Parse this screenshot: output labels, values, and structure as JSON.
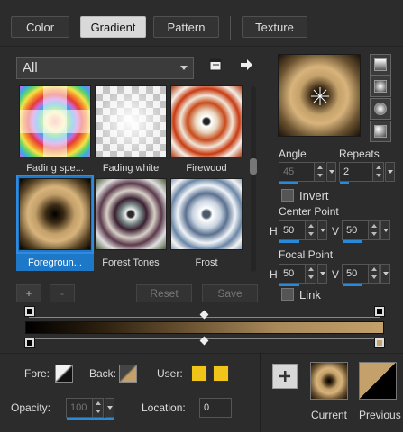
{
  "tabs": [
    {
      "label": "Color"
    },
    {
      "label": "Gradient"
    },
    {
      "label": "Pattern"
    },
    {
      "label": "Texture"
    }
  ],
  "category": {
    "value": "All"
  },
  "gradients": [
    {
      "name": "Fading spe..."
    },
    {
      "name": "Fading white"
    },
    {
      "name": "Firewood"
    },
    {
      "name": "Foregroun..."
    },
    {
      "name": "Forest Tones"
    },
    {
      "name": "Frost"
    }
  ],
  "list_buttons": {
    "add": "+",
    "remove": "-",
    "reset": "Reset",
    "save": "Save"
  },
  "angle": {
    "label": "Angle",
    "value": "45"
  },
  "repeats": {
    "label": "Repeats",
    "value": "2"
  },
  "invert": {
    "label": "Invert",
    "checked": false
  },
  "center_point": {
    "label": "Center Point",
    "h_label": "H",
    "h_value": "50",
    "v_label": "V",
    "v_value": "50"
  },
  "focal_point": {
    "label": "Focal Point",
    "h_label": "H",
    "h_value": "50",
    "v_label": "V",
    "v_value": "50"
  },
  "link": {
    "label": "Link",
    "checked": false
  },
  "fore": {
    "label": "Fore:"
  },
  "back": {
    "label": "Back:"
  },
  "user": {
    "label": "User:",
    "color1": "#f0c419",
    "color2": "#f0c419"
  },
  "opacity": {
    "label": "Opacity:",
    "value": "100"
  },
  "location": {
    "label": "Location:",
    "value": "0"
  },
  "current": {
    "label": "Current"
  },
  "previous": {
    "label": "Previous"
  },
  "colors": {
    "accent": "#2b8ad8",
    "panel": "#2c2c2c",
    "gradient_start": "#000000",
    "gradient_end": "#c4a06a"
  },
  "icons": [
    "file-icon",
    "arrow-right-icon",
    "plus-icon"
  ]
}
